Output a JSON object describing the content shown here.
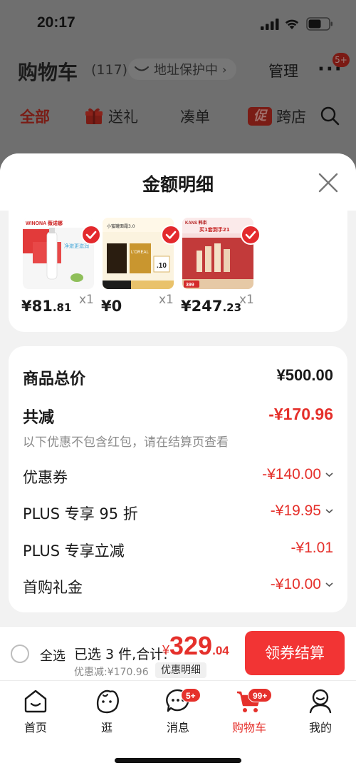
{
  "status_bar": {
    "time": "20:17"
  },
  "header": {
    "title": "购物车",
    "count": "(117)",
    "address_protect": "地址保护中",
    "manage": "管理",
    "more_badge": "5+"
  },
  "filter_tabs": [
    {
      "label": "全部"
    },
    {
      "label": "送礼"
    },
    {
      "label": "凑单"
    },
    {
      "label": "跨店",
      "icon_text": "促"
    }
  ],
  "sheet": {
    "title": "金额明细",
    "products": [
      {
        "price_int": "¥81",
        "price_dec": ".81",
        "qty": "x1",
        "brand_text": "WINONA 薇诺娜",
        "caption": "净澈更滋润"
      },
      {
        "price_int": "¥0",
        "price_dec": "",
        "qty": "x1",
        "brand_text": "小蜜罐面霜3.0",
        "caption": "L'OREAL"
      },
      {
        "price_int": "¥247",
        "price_dec": ".23",
        "qty": "x1",
        "brand_text": "KANS 韩束",
        "caption": "买1套到手21"
      }
    ],
    "summary": {
      "total_label": "商品总价",
      "total_value": "¥500.00",
      "reduce_label": "共减",
      "reduce_value": "-¥170.96",
      "reduce_note": "以下优惠不包含红包，请在结算页查看",
      "rows": [
        {
          "label": "优惠券",
          "value": "-¥140.00",
          "expandable": true
        },
        {
          "label": "PLUS 专享 95 折",
          "value": "-¥19.95",
          "expandable": true
        },
        {
          "label": "PLUS 专享立减",
          "value": "-¥1.01",
          "expandable": false
        },
        {
          "label": "首购礼金",
          "value": "-¥10.00",
          "expandable": true
        }
      ]
    }
  },
  "checkout": {
    "select_all": "全选",
    "selected_text": "已选 3 件,合计:",
    "total_sym": "¥",
    "total_int": "329",
    "total_dec": ".04",
    "discount_text": "优惠减:¥170.96",
    "detail_label": "优惠明细",
    "button": "领券结算"
  },
  "tab_bar": {
    "items": [
      {
        "label": "首页",
        "icon": "home-icon"
      },
      {
        "label": "逛",
        "icon": "browse-face-icon"
      },
      {
        "label": "消息",
        "icon": "message-icon",
        "badge": "5+"
      },
      {
        "label": "购物车",
        "icon": "cart-icon",
        "badge": "99+",
        "active": true
      },
      {
        "label": "我的",
        "icon": "profile-icon"
      }
    ]
  },
  "colors": {
    "accent_red": "#e5302b",
    "button_red": "#f23434",
    "overlay": "#6f6f6f"
  }
}
